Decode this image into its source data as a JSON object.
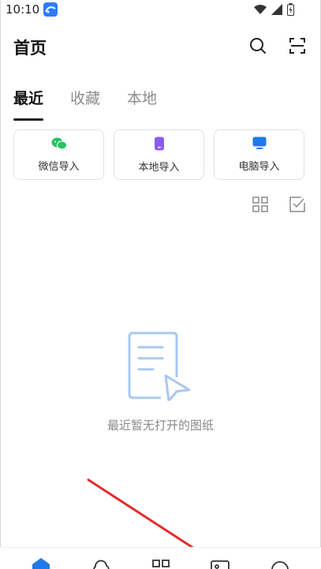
{
  "status_bar": {
    "time": "10:10",
    "icons": [
      "app-icon",
      "wifi-icon",
      "signal-icon",
      "battery-icon"
    ]
  },
  "header": {
    "title": "首页",
    "actions": [
      "search-icon",
      "scan-icon"
    ]
  },
  "tabs": [
    {
      "label": "最近",
      "active": true
    },
    {
      "label": "收藏",
      "active": false
    },
    {
      "label": "本地",
      "active": false
    }
  ],
  "import_options": [
    {
      "label": "微信导入",
      "icon": "wechat-icon",
      "color": "#22c55e"
    },
    {
      "label": "本地导入",
      "icon": "phone-icon",
      "color": "#8b5cf6"
    },
    {
      "label": "电脑导入",
      "icon": "monitor-icon",
      "color": "#1f7ae8"
    }
  ],
  "view_tools": [
    "grid-view-icon",
    "select-check-icon"
  ],
  "empty_state": {
    "message": "最近暂无打开的图纸",
    "icon": "document-icon"
  },
  "bottom_nav": {
    "items": [
      "home-icon",
      "cloud-icon",
      "apps-icon",
      "gallery-icon",
      "profile-icon"
    ],
    "active_color": "#1f7ae8"
  },
  "colors": {
    "accent": "#1f7ae8",
    "arrow": "#e52b2b"
  }
}
